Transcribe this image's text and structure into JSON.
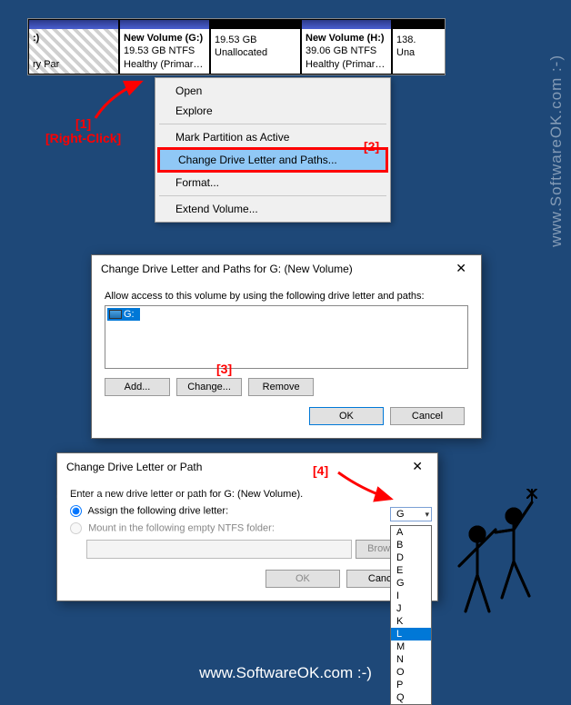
{
  "partitions": {
    "c": {
      "name": ":)",
      "size": "",
      "status": "ry Par"
    },
    "g": {
      "name": "New Volume  (G:)",
      "size": "19.53 GB NTFS",
      "status": "Healthy (Primary P:"
    },
    "unalloc": {
      "size": "19.53 GB",
      "status": "Unallocated"
    },
    "h": {
      "name": "New Volume  (H:)",
      "size": "39.06 GB NTFS",
      "status": "Healthy (Primary Par"
    },
    "tail": {
      "size": "138.",
      "status": "Una"
    }
  },
  "context_menu": {
    "open": "Open",
    "explore": "Explore",
    "mark_active": "Mark Partition as Active",
    "change_letter": "Change Drive Letter and Paths...",
    "format": "Format...",
    "extend": "Extend Volume..."
  },
  "annotations": {
    "a1_num": "[1]",
    "a1_text": "[Right-Click]",
    "a2": "[2]",
    "a3": "[3]",
    "a4": "[4]"
  },
  "dialog1": {
    "title": "Change Drive Letter and Paths for G: (New Volume)",
    "instruction": "Allow access to this volume by using the following drive letter and paths:",
    "drive": "G:",
    "add": "Add...",
    "change": "Change...",
    "remove": "Remove",
    "ok": "OK",
    "cancel": "Cancel"
  },
  "dialog2": {
    "title": "Change Drive Letter or Path",
    "instruction": "Enter a new drive letter or path for G: (New Volume).",
    "opt_assign": "Assign the following drive letter:",
    "opt_mount": "Mount in the following empty NTFS folder:",
    "browse": "Browse...",
    "ok": "OK",
    "cancel": "Cancel",
    "selected": "G",
    "letters": [
      "A",
      "B",
      "D",
      "E",
      "G",
      "I",
      "J",
      "K",
      "L",
      "M",
      "N",
      "O",
      "P",
      "Q"
    ]
  },
  "watermark": {
    "side": "www.SoftwareOK.com :-)",
    "bottom": "www.SoftwareOK.com :-)",
    "center": "SoftwareOK"
  }
}
